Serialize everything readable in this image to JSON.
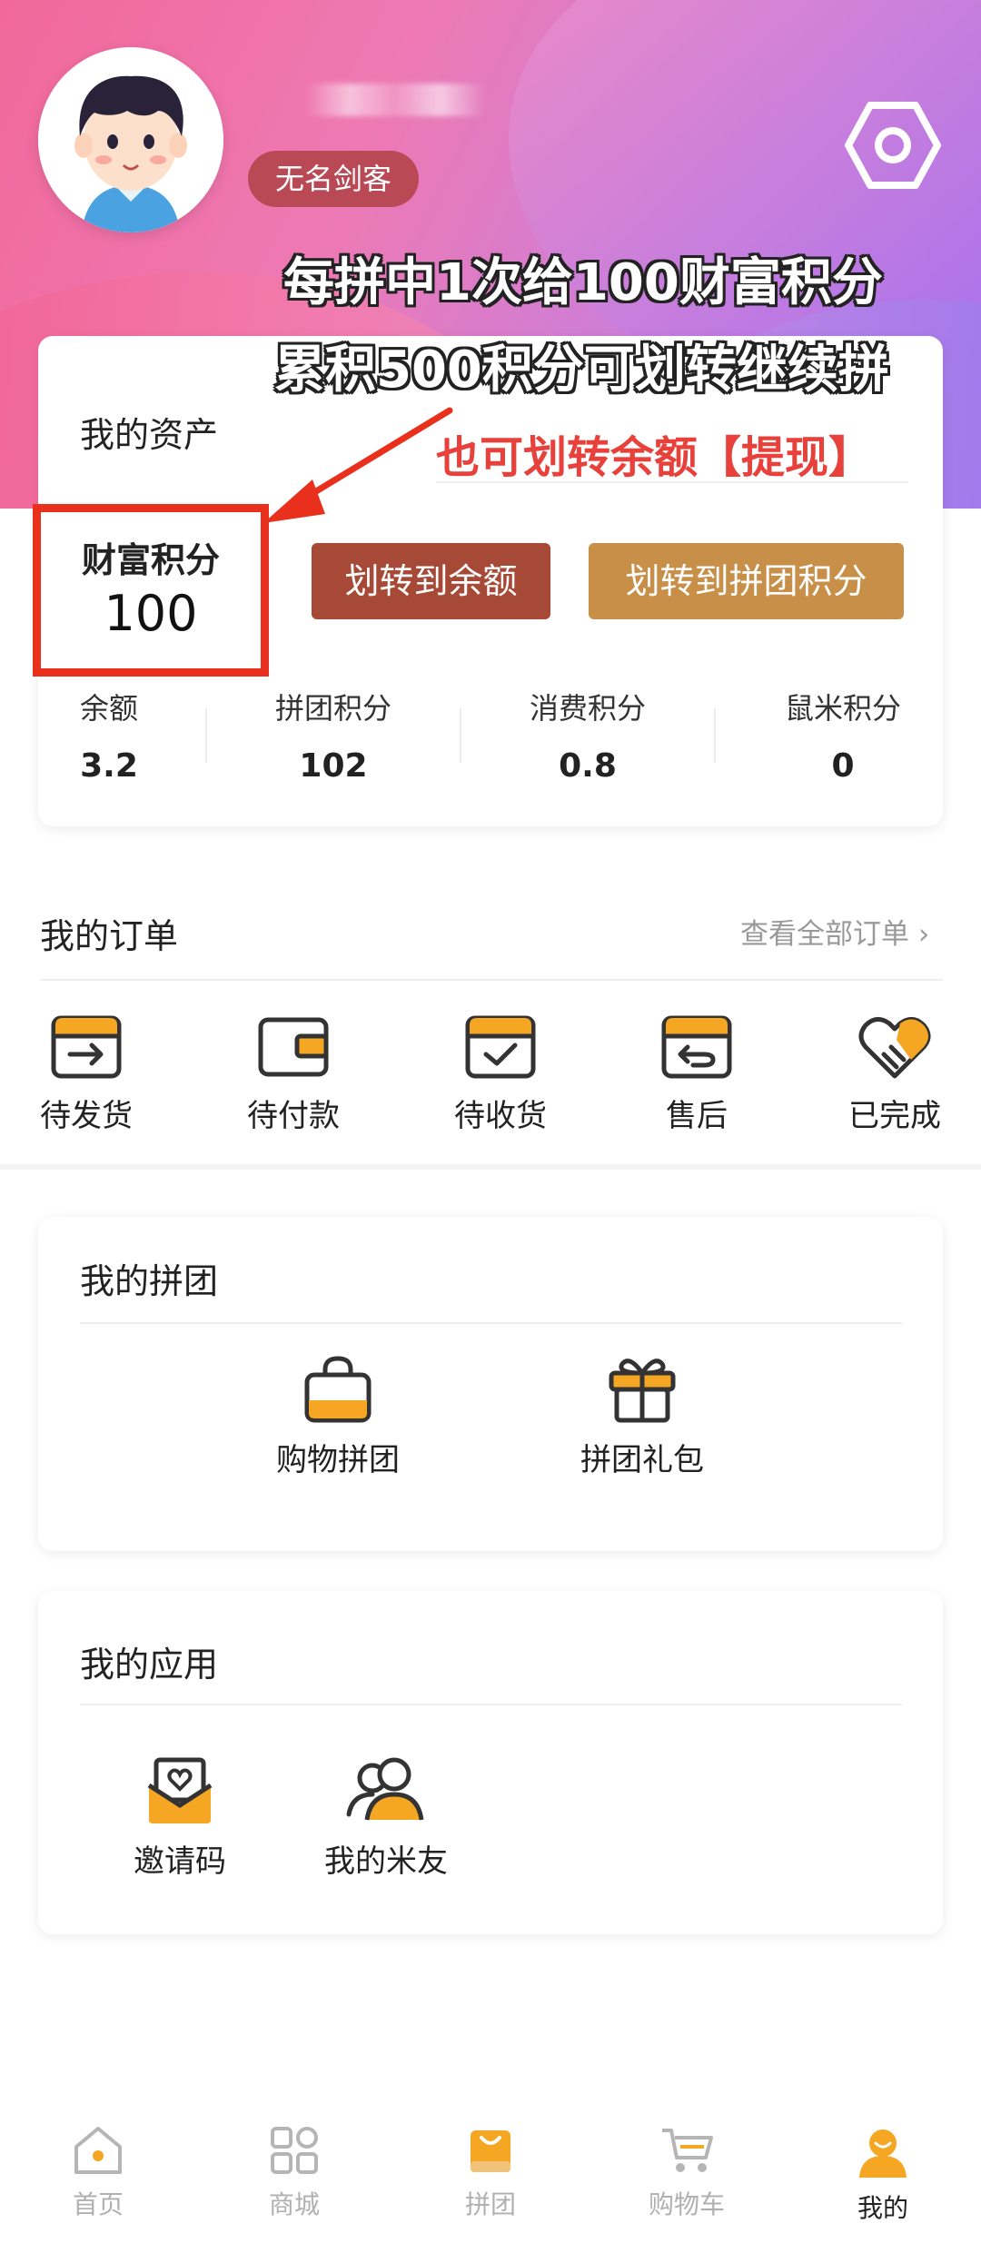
{
  "profile": {
    "level_badge": "无名剑客"
  },
  "promo": {
    "line1": "每拼中1次给100财富积分",
    "line2": "累积500积分可划转继续拼",
    "note": "也可划转余额【提现】"
  },
  "assets": {
    "title": "我的资产",
    "wealth_label": "财富积分",
    "wealth_value": "100",
    "btn_to_balance": "划转到余额",
    "btn_to_group": "划转到拼团积分",
    "stats": [
      {
        "label": "余额",
        "value": "3.2"
      },
      {
        "label": "拼团积分",
        "value": "102"
      },
      {
        "label": "消费积分",
        "value": "0.8"
      },
      {
        "label": "鼠米积分",
        "value": "0"
      }
    ]
  },
  "orders": {
    "title": "我的订单",
    "view_all": "查看全部订单 ›",
    "items": [
      {
        "label": "待发货",
        "icon": "ship-box-icon"
      },
      {
        "label": "待付款",
        "icon": "wallet-icon"
      },
      {
        "label": "待收货",
        "icon": "receive-box-icon"
      },
      {
        "label": "售后",
        "icon": "return-box-icon"
      },
      {
        "label": "已完成",
        "icon": "heart-hand-icon"
      }
    ]
  },
  "groups": {
    "title": "我的拼团",
    "items": [
      {
        "label": "购物拼团",
        "icon": "shopping-bag-icon"
      },
      {
        "label": "拼团礼包",
        "icon": "gift-icon"
      }
    ]
  },
  "apps": {
    "title": "我的应用",
    "items": [
      {
        "label": "邀请码",
        "icon": "invite-envelope-icon"
      },
      {
        "label": "我的米友",
        "icon": "friends-icon"
      }
    ]
  },
  "tabbar": {
    "items": [
      {
        "label": "首页",
        "icon": "home-icon"
      },
      {
        "label": "商城",
        "icon": "grid-icon"
      },
      {
        "label": "拼团",
        "icon": "group-bag-icon"
      },
      {
        "label": "购物车",
        "icon": "cart-icon"
      },
      {
        "label": "我的",
        "icon": "profile-icon"
      }
    ],
    "active_index": 4
  },
  "colors": {
    "accent_orange": "#f5a623",
    "badge_red": "#b94a55",
    "highlight_red": "#e8301c",
    "btn_balance": "#a64937",
    "btn_group": "#c78f48"
  }
}
